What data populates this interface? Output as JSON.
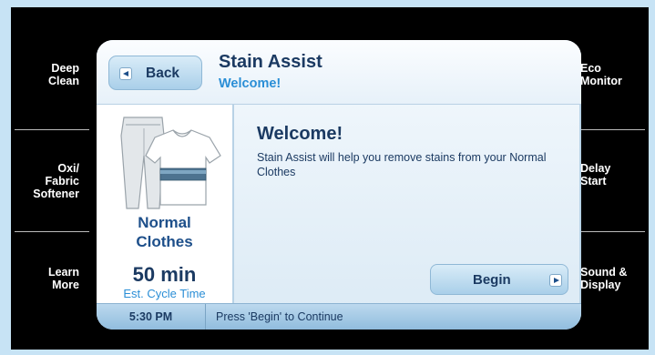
{
  "side_buttons": {
    "deep_clean": "Deep\nClean",
    "oxi_fabric_softener": "Oxi/\nFabric\nSoftener",
    "learn_more": "Learn\nMore",
    "eco_monitor": "Eco\nMonitor",
    "delay_start": "Delay\nStart",
    "sound_display": "Sound &\nDisplay"
  },
  "header": {
    "back_label": "Back",
    "title": "Stain Assist",
    "subtitle": "Welcome!"
  },
  "cycle": {
    "name_line1": "Normal",
    "name_line2": "Clothes",
    "time_value": "50 min",
    "time_label": "Est. Cycle Time"
  },
  "content": {
    "heading": "Welcome!",
    "text": "Stain Assist will help you remove stains from your Normal Clothes",
    "begin_label": "Begin"
  },
  "status": {
    "clock": "5:30 PM",
    "message": "Press 'Begin' to Continue"
  },
  "icons": [
    "back-arrow-icon",
    "forward-arrow-icon",
    "clothes-icon"
  ],
  "colors": {
    "background": "#c7e3f5",
    "bezel": "#000000",
    "accent_blue": "#2a8ed6",
    "text_navy": "#1b3a62"
  }
}
